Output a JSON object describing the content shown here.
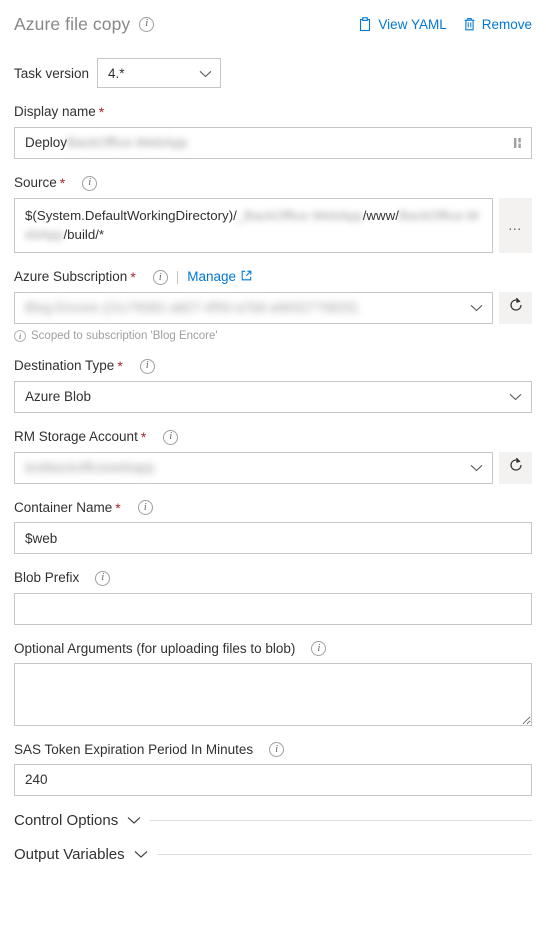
{
  "header": {
    "title": "Azure file copy",
    "info_icon": "info-icon",
    "actions": [
      {
        "label": "View YAML",
        "icon": "clipboard-icon"
      },
      {
        "label": "Remove",
        "icon": "trash-icon"
      }
    ]
  },
  "task_version": {
    "label": "Task version",
    "value": "4.*",
    "chevron": "chevron-down-icon"
  },
  "fields": {
    "display_name": {
      "label": "Display name",
      "required": "*",
      "value_prefix": "Deploy ",
      "value_redacted": "BackOffice.WebApp",
      "picker_icon": "variable-picker-icon"
    },
    "source": {
      "label": "Source",
      "required": "*",
      "value_part1": "$(System.DefaultWorkingDirectory)/",
      "value_redacted1": "_BackOffice.WebApp",
      "value_part2": "/www/",
      "value_redacted2": "BackOffice.WebApp",
      "value_part3": "/build/*",
      "browse_label": "…"
    },
    "azure_subscription": {
      "label": "Azure Subscription",
      "required": "*",
      "manage_label": "Manage",
      "manage_icon": "external-link-icon",
      "value_redacted": "Blog Encore (21c76081-a827-4f50-a7b6-a9932779925)",
      "refresh_icon": "refresh-icon",
      "helper": "Scoped to subscription 'Blog Encore'"
    },
    "destination_type": {
      "label": "Destination Type",
      "required": "*",
      "value": "Azure Blob"
    },
    "rm_storage_account": {
      "label": "RM Storage Account",
      "required": "*",
      "value_redacted": "testbackofficewebapp",
      "refresh_icon": "refresh-icon"
    },
    "container_name": {
      "label": "Container Name",
      "required": "*",
      "value": "$web"
    },
    "blob_prefix": {
      "label": "Blob Prefix",
      "value": "",
      "placeholder": ""
    },
    "optional_arguments": {
      "label": "Optional Arguments (for uploading files to blob)",
      "value": "",
      "placeholder": ""
    },
    "sas_token": {
      "label": "SAS Token Expiration Period In Minutes",
      "value": "240"
    }
  },
  "sections": [
    {
      "title": "Control Options",
      "chevron": "chevron-down-icon"
    },
    {
      "title": "Output Variables",
      "chevron": "chevron-down-icon"
    }
  ],
  "colors": {
    "link": "#0078d4",
    "required": "#a4262c",
    "border": "#c8c6c4",
    "button_bg": "#f3f2f1",
    "title": "#8a8886"
  }
}
